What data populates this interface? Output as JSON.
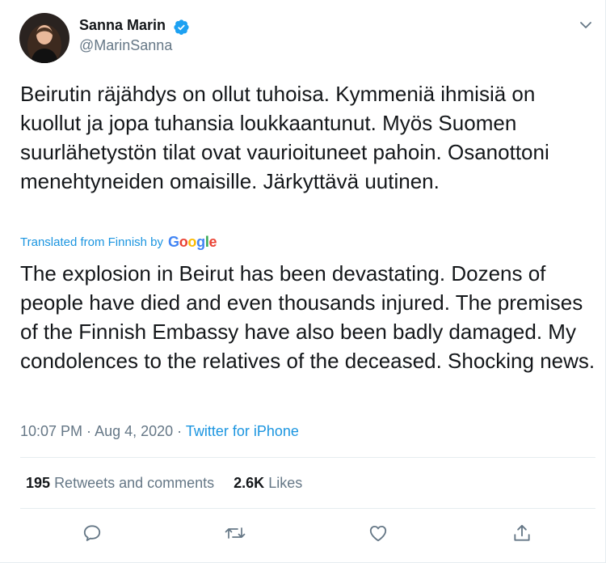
{
  "author": {
    "name": "Sanna Marin",
    "handle": "@MarinSanna",
    "verified": true,
    "verified_icon": "verified-badge-icon",
    "avatar_icon": "avatar-photo"
  },
  "menu_icon": "chevron-down-icon",
  "tweet": {
    "original_text": "Beirutin räjähdys on ollut tuhoisa. Kymmeniä ihmisiä on kuollut ja jopa tuhansia loukkaantunut. Myös Suomen suurlähetystön tilat ovat vaurioituneet pahoin. Osanottoni menehtyneiden omaisille. Järkyttävä uutinen.",
    "translated_by_label": "Translated from Finnish by",
    "translator_logo": {
      "letters": [
        "G",
        "o",
        "o",
        "g",
        "l",
        "e"
      ],
      "colors": [
        "#4285F4",
        "#EA4335",
        "#FBBC05",
        "#4285F4",
        "#34A853",
        "#EA4335"
      ]
    },
    "translated_text": "The explosion in Beirut has been devastating. Dozens of people have died and even thousands injured. The premises of the Finnish Embassy have also been badly damaged. My condolences to the relatives of the deceased. Shocking news."
  },
  "meta": {
    "time": "10:07 PM",
    "separator": " · ",
    "date": "Aug 4, 2020",
    "source": "Twitter for iPhone"
  },
  "stats": {
    "retweets_count": "195",
    "retweets_label": "Retweets and comments",
    "likes_count": "2.6K",
    "likes_label": "Likes"
  },
  "actions": [
    {
      "name": "reply-icon"
    },
    {
      "name": "retweet-icon"
    },
    {
      "name": "like-icon"
    },
    {
      "name": "share-icon"
    }
  ],
  "colors": {
    "accent": "#1b95e0",
    "text": "#14171a",
    "secondary_text": "#657786",
    "divider": "#e6ecf0"
  }
}
